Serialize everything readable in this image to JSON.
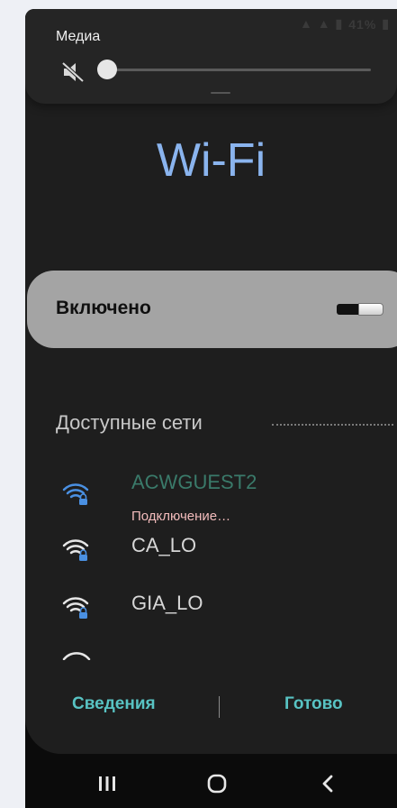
{
  "status_bar": {
    "battery": "41%"
  },
  "media": {
    "label": "Медиа",
    "volume_level": 0
  },
  "title": "Wi‑Fi",
  "toggle": {
    "label": "Включено",
    "state": true
  },
  "section": {
    "title": "Доступные сети"
  },
  "networks": [
    {
      "name": "ACWGUEST2",
      "status": "Подключение…",
      "secured": true
    },
    {
      "name": "CA_LO",
      "status": "",
      "secured": true
    },
    {
      "name": "GIA_LO",
      "status": "",
      "secured": true
    }
  ],
  "footer": {
    "details_label": "Сведения",
    "done_label": "Готово"
  },
  "colors": {
    "accent_title": "#8ab4ee",
    "button": "#58c3c3",
    "connecting": "#f3bcbc",
    "wifi_active": "#4a90e2"
  }
}
